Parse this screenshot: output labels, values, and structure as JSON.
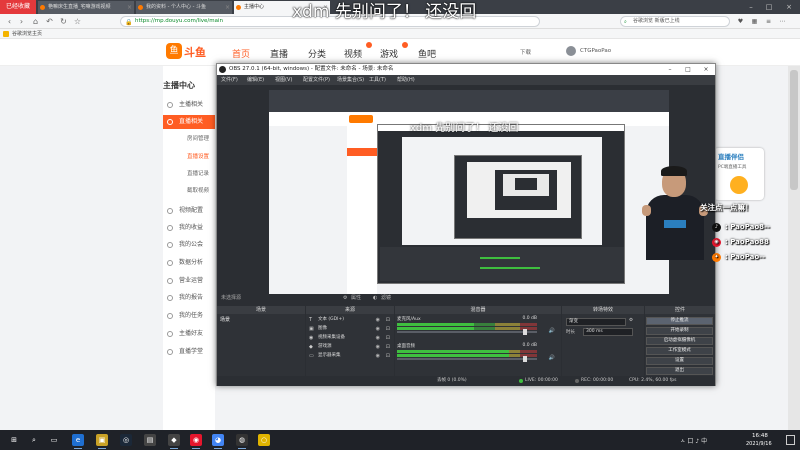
{
  "overlay": {
    "title": "xdm 先别问了！ 还没回",
    "inner_title": "xdm 先别问了！ 还没回"
  },
  "browser": {
    "badge": "已经收藏",
    "tabs": [
      {
        "label": "艳嘛床生直播_宅嘛游戏视频"
      },
      {
        "label": "我的资料 - 个人中心 - 斗鱼"
      },
      {
        "label": "主播中心"
      }
    ],
    "url": "https://mp.douyu.com/live/main",
    "search_placeholder": "谷歌浏览 新版已上线",
    "bookmark": "谷歌浏览主页"
  },
  "site": {
    "logo_text": "斗鱼",
    "nav": [
      {
        "label": "首页"
      },
      {
        "label": "直播"
      },
      {
        "label": "分类"
      },
      {
        "label": "视频"
      },
      {
        "label": "游戏"
      },
      {
        "label": "鱼吧"
      }
    ],
    "download": "下载",
    "username": "CTGPaoPao"
  },
  "sidebar": {
    "title": "主播中心",
    "items": [
      {
        "label": "主播相关"
      },
      {
        "label": "直播相关"
      },
      {
        "label": "视频配置"
      },
      {
        "label": "我的收益"
      },
      {
        "label": "我的公会"
      },
      {
        "label": "数据分析"
      },
      {
        "label": "营业运营"
      },
      {
        "label": "我的报告"
      },
      {
        "label": "我的任务"
      },
      {
        "label": "主播好友"
      },
      {
        "label": "直播学堂"
      }
    ],
    "subs": [
      {
        "label": "房间管理"
      },
      {
        "label": "直播设置"
      },
      {
        "label": "直播记录"
      },
      {
        "label": "截取视频"
      }
    ]
  },
  "obs": {
    "title": "OBS 27.0.1 (64-bit, windows) - 配置文件: 未命名 - 场景: 未命名",
    "menu": [
      {
        "label": "文件(F)"
      },
      {
        "label": "编辑(E)"
      },
      {
        "label": "视图(V)"
      },
      {
        "label": "配置文件(P)"
      },
      {
        "label": "场景集合(S)"
      },
      {
        "label": "工具(T)"
      },
      {
        "label": "帮助(H)"
      }
    ],
    "no_source": "未选择源",
    "properties": "属性",
    "filters": "滤镜",
    "docks": {
      "scenes": "场景",
      "sources": "来源",
      "mixer": "混音器",
      "transitions": "转场特效",
      "controls": "控件"
    },
    "scene_item": "场景",
    "sources": [
      {
        "label": "文本 (GDI+)",
        "icon": "T"
      },
      {
        "label": "图像",
        "icon": "▣"
      },
      {
        "label": "视频采集设备",
        "icon": "◉"
      },
      {
        "label": "游戏源",
        "icon": "◆"
      },
      {
        "label": "显示器采集",
        "icon": "▭"
      }
    ],
    "mixer": [
      {
        "label": "麦克风/Aux",
        "db": "0.0 dB",
        "level": 0.55,
        "volume": 0.93
      },
      {
        "label": "桌面音频",
        "db": "0.0 dB",
        "level": 0.8,
        "volume": 0.93
      }
    ],
    "transition": {
      "type": "渐变",
      "duration_label": "时长",
      "duration": "300 ms"
    },
    "controls": [
      {
        "label": "停止推流"
      },
      {
        "label": "开始录制"
      },
      {
        "label": "启动虚拟摄像机"
      },
      {
        "label": "工作室模式"
      },
      {
        "label": "设置"
      },
      {
        "label": "退出"
      }
    ],
    "status": {
      "drop": "丢帧 0 (0.0%)",
      "live": "LIVE: 00:00:00",
      "rec": "REC: 00:00:00",
      "cpu": "CPU: 2.4%, 60.00 fps"
    }
  },
  "streamer_overlay": {
    "follow": "关注点一点嘛！",
    "socials": [
      {
        "label": ": PaoPao8--",
        "icon": "♪",
        "color": "#111111"
      },
      {
        "label": ": PaoPao88",
        "icon": "◉",
        "color": "#e6162d"
      },
      {
        "label": ": PaoPao--",
        "icon": "✦",
        "color": "#ff7a00"
      }
    ],
    "ad_title": "直播伴侣",
    "ad_sub": "PC端直播工具"
  },
  "taskbar": {
    "time": "16:48",
    "date": "2021/9/16",
    "tray": "ㅅ 口 ♪ 中"
  },
  "colors": {
    "brand": "#ff5d23",
    "obs_bg": "#2b2e33"
  }
}
